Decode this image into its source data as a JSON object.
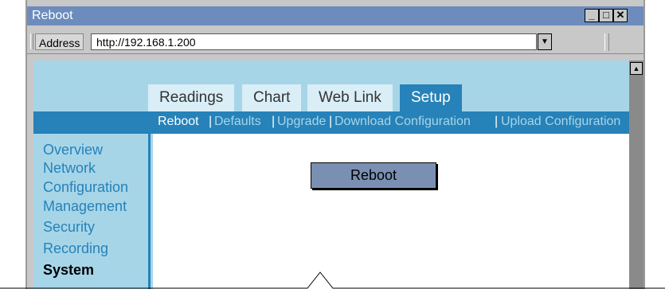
{
  "window": {
    "title": "Reboot",
    "controls": {
      "minimize": "_",
      "maximize": "□",
      "close": "✕"
    }
  },
  "address_bar": {
    "label": "Address",
    "url": "http://192.168.1.200",
    "dropdown_icon": "▼"
  },
  "scrollbar": {
    "up_icon": "▲"
  },
  "tabs": [
    {
      "label": "Readings",
      "active": false
    },
    {
      "label": "Chart",
      "active": false
    },
    {
      "label": "Web Link",
      "active": false
    },
    {
      "label": "Setup",
      "active": true
    }
  ],
  "subnav": [
    {
      "label": "Reboot",
      "current": true
    },
    {
      "label": "Defaults",
      "current": false
    },
    {
      "label": "Upgrade",
      "current": false
    },
    {
      "label": "Download Configuration",
      "current": false
    },
    {
      "label": "Upload Configuration",
      "current": false
    }
  ],
  "sidebar": [
    {
      "label": "Overview"
    },
    {
      "label": "Network"
    },
    {
      "label": "Configuration"
    },
    {
      "label": "Management"
    },
    {
      "label": "Security"
    },
    {
      "label": "Recording"
    },
    {
      "label": "System",
      "bold": true
    }
  ],
  "main": {
    "reboot_button": "Reboot"
  },
  "colors": {
    "accent": "#2682b8",
    "page_bg": "#a7d5e8",
    "titlebar": "#6d8cbd",
    "button": "#7a90b3"
  }
}
